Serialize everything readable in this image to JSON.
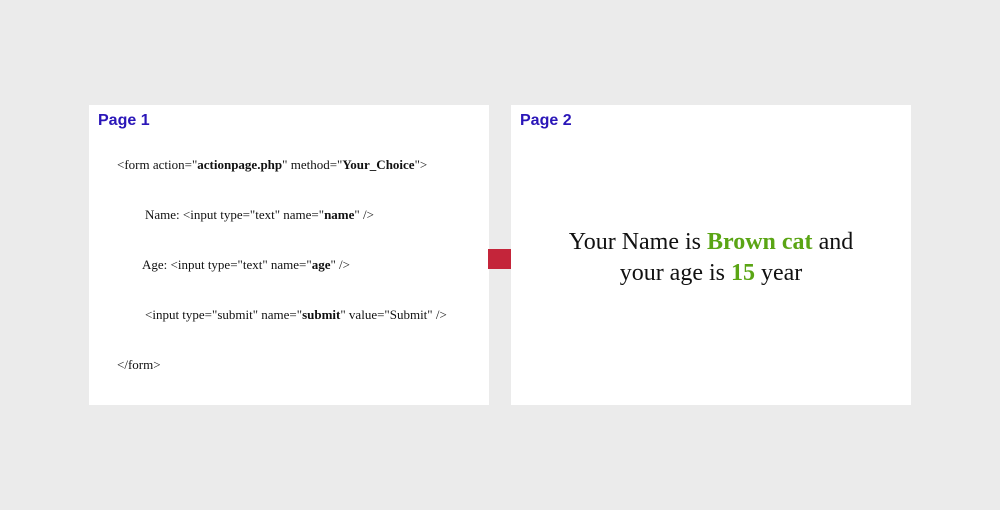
{
  "page1": {
    "title": "Page 1",
    "code": {
      "form_open": {
        "prefix": "<form action=\"",
        "action": "actionpage.php",
        "mid": "\" method=\"",
        "method": "Your_Choice",
        "suffix": "\">"
      },
      "name_line": {
        "prefix": "Name: <input type=\"text\" name=\"",
        "name": "name",
        "suffix": "\" />"
      },
      "age_line": {
        "prefix": "Age: <input type=\"text\" name=\"",
        "name": "age",
        "suffix": "\" />"
      },
      "submit_line": {
        "prefix": "<input type=\"submit\" name=\"",
        "name": "submit",
        "suffix": "\" value=\"Submit\" />"
      },
      "form_close": "</form>"
    }
  },
  "page2": {
    "title": "Page 2",
    "result": {
      "part1": "Your Name is ",
      "name_value": "Brown cat",
      "part2": " and",
      "part3": "your age is ",
      "age_value": "15",
      "part4": " year"
    }
  },
  "colors": {
    "title": "#2a16b8",
    "highlight": "#5aa514",
    "arrow": "#c4253a",
    "background": "#ebebeb"
  },
  "icons": {
    "arrow": "right-arrow-icon"
  }
}
